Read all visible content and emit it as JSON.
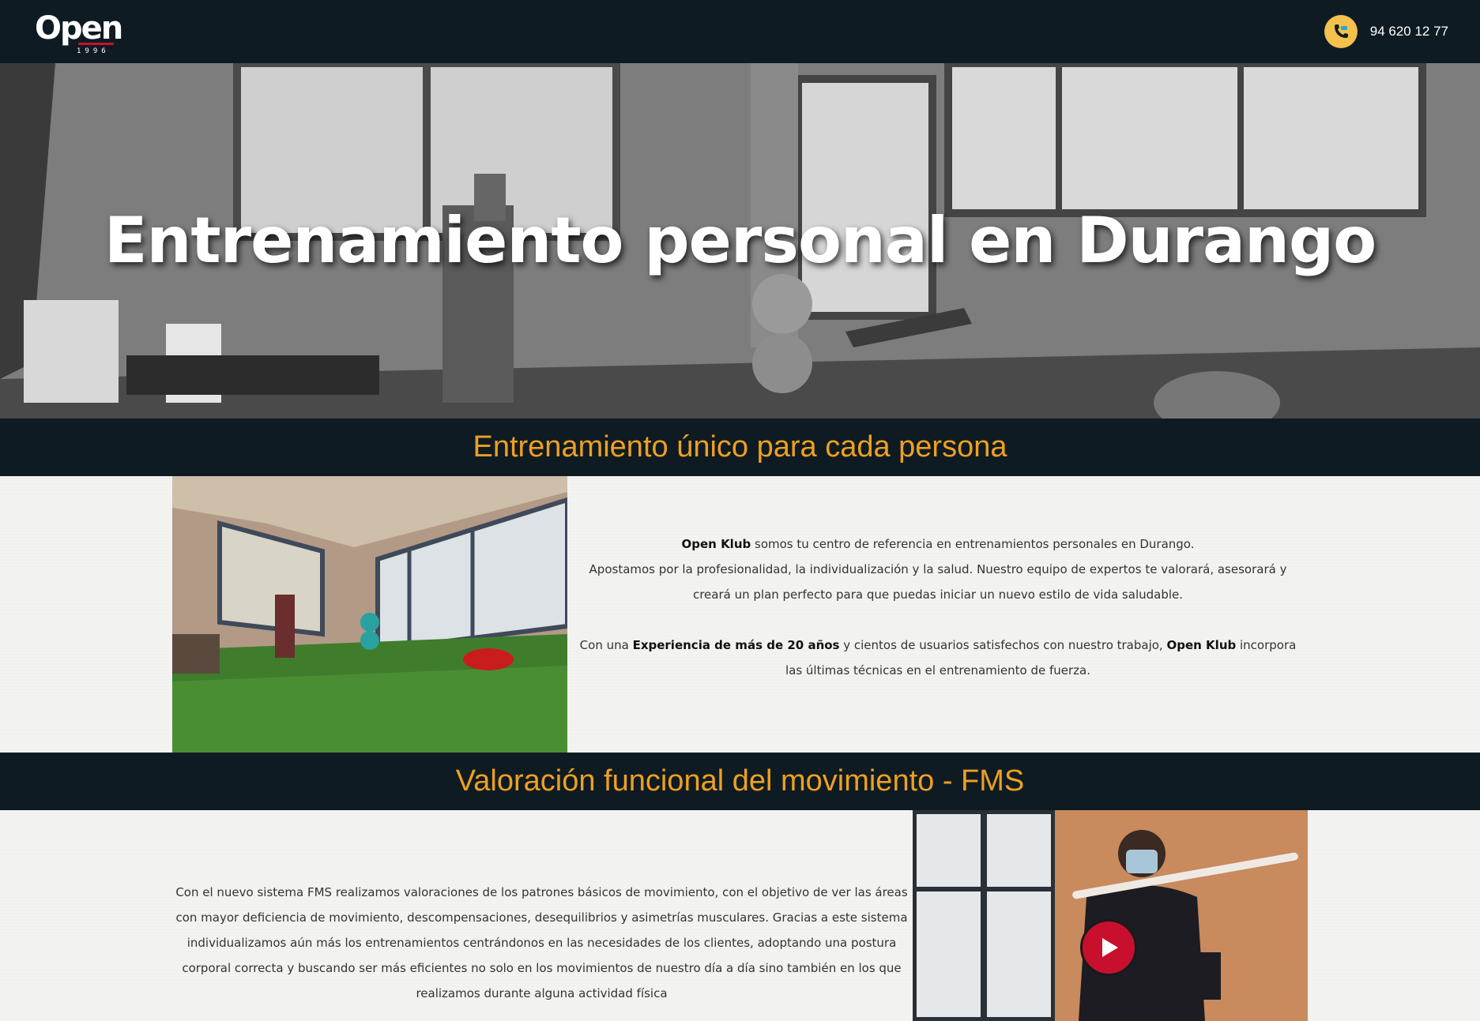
{
  "header": {
    "logo_text": "Open",
    "logo_year": "1996",
    "phone_number": "94 620 12 77",
    "phone_icon": "phone-icon"
  },
  "hero": {
    "title": "Entrenamiento personal en Durango"
  },
  "section1": {
    "heading": "Entrenamiento único para cada persona",
    "p1_bold": "Open Klub",
    "p1_rest": " somos tu centro de referencia en entrenamientos personales en Durango.",
    "p2": "Apostamos por la profesionalidad, la individualización y la salud. Nuestro equipo de expertos te valorará, asesorará y creará un plan perfecto para que puedas iniciar un nuevo estilo de vida saludable.",
    "p3_a": "Con una ",
    "p3_bold1": "Experiencia de más de 20 años",
    "p3_b": " y cientos de usuarios satisfechos con nuestro trabajo, ",
    "p3_bold2": "Open Klub",
    "p3_c": " incorpora las últimas técnicas en el entrenamiento de fuerza."
  },
  "section2": {
    "heading": "Valoración funcional del movimiento - FMS",
    "body": "Con el nuevo sistema FMS realizamos valoraciones de los patrones básicos de movimiento, con el objetivo de ver las áreas con mayor deficiencia de movimiento, descompensaciones, desequilibrios y asimetrías musculares. Gracias a este sistema individualizamos aún más los entrenamientos centrándonos en las necesidades de los clientes, adoptando una postura corporal correcta y buscando ser más eficientes no solo en los movimientos de nuestro día a día sino también en los que realizamos durante alguna actividad física",
    "play_icon": "play-icon"
  },
  "colors": {
    "dark": "#0f1b22",
    "accent": "#eda021",
    "phone_badge": "#f3c14c",
    "play": "#c8102e"
  }
}
